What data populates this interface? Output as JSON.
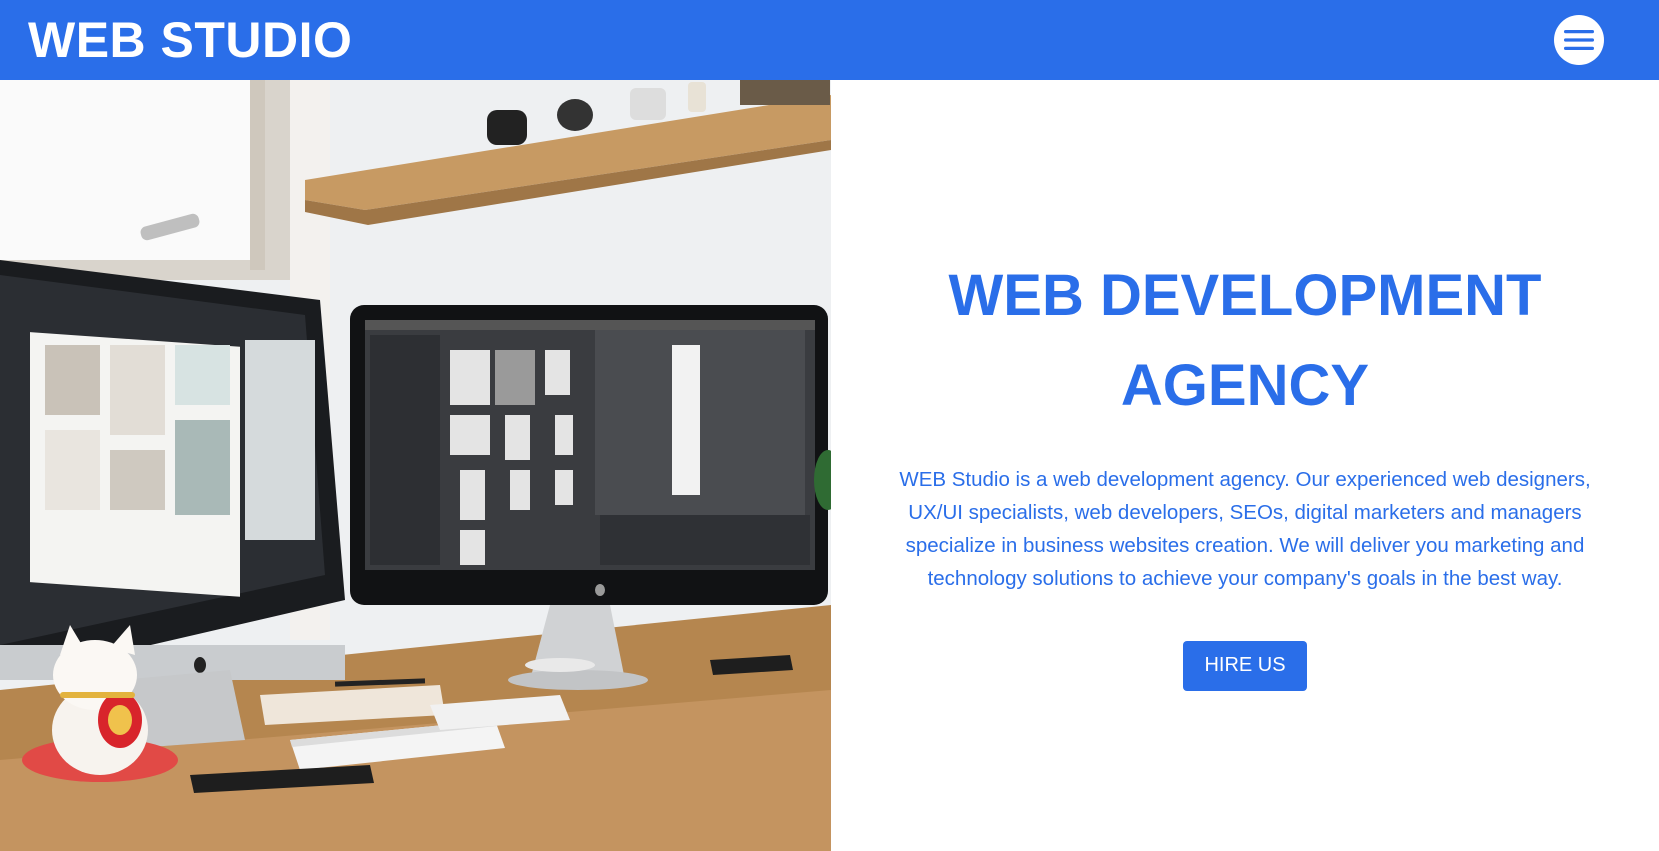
{
  "header": {
    "logo": "WEB STUDIO",
    "menu_icon": "hamburger-menu-icon"
  },
  "hero": {
    "image_description_icon": "desk-with-monitors-photo",
    "title": "WEB DEVELOPMENT AGENCY",
    "description": "WEB Studio is a web development agency. Our experienced web designers, UX/UI specialists, web developers, SEOs, digital marketers and managers specialize in business websites creation. We will deliver you marketing and technology solutions to achieve your company's goals in the best way.",
    "cta_label": "HIRE US"
  },
  "colors": {
    "brand": "#2a6ee9",
    "background": "#ffffff"
  }
}
